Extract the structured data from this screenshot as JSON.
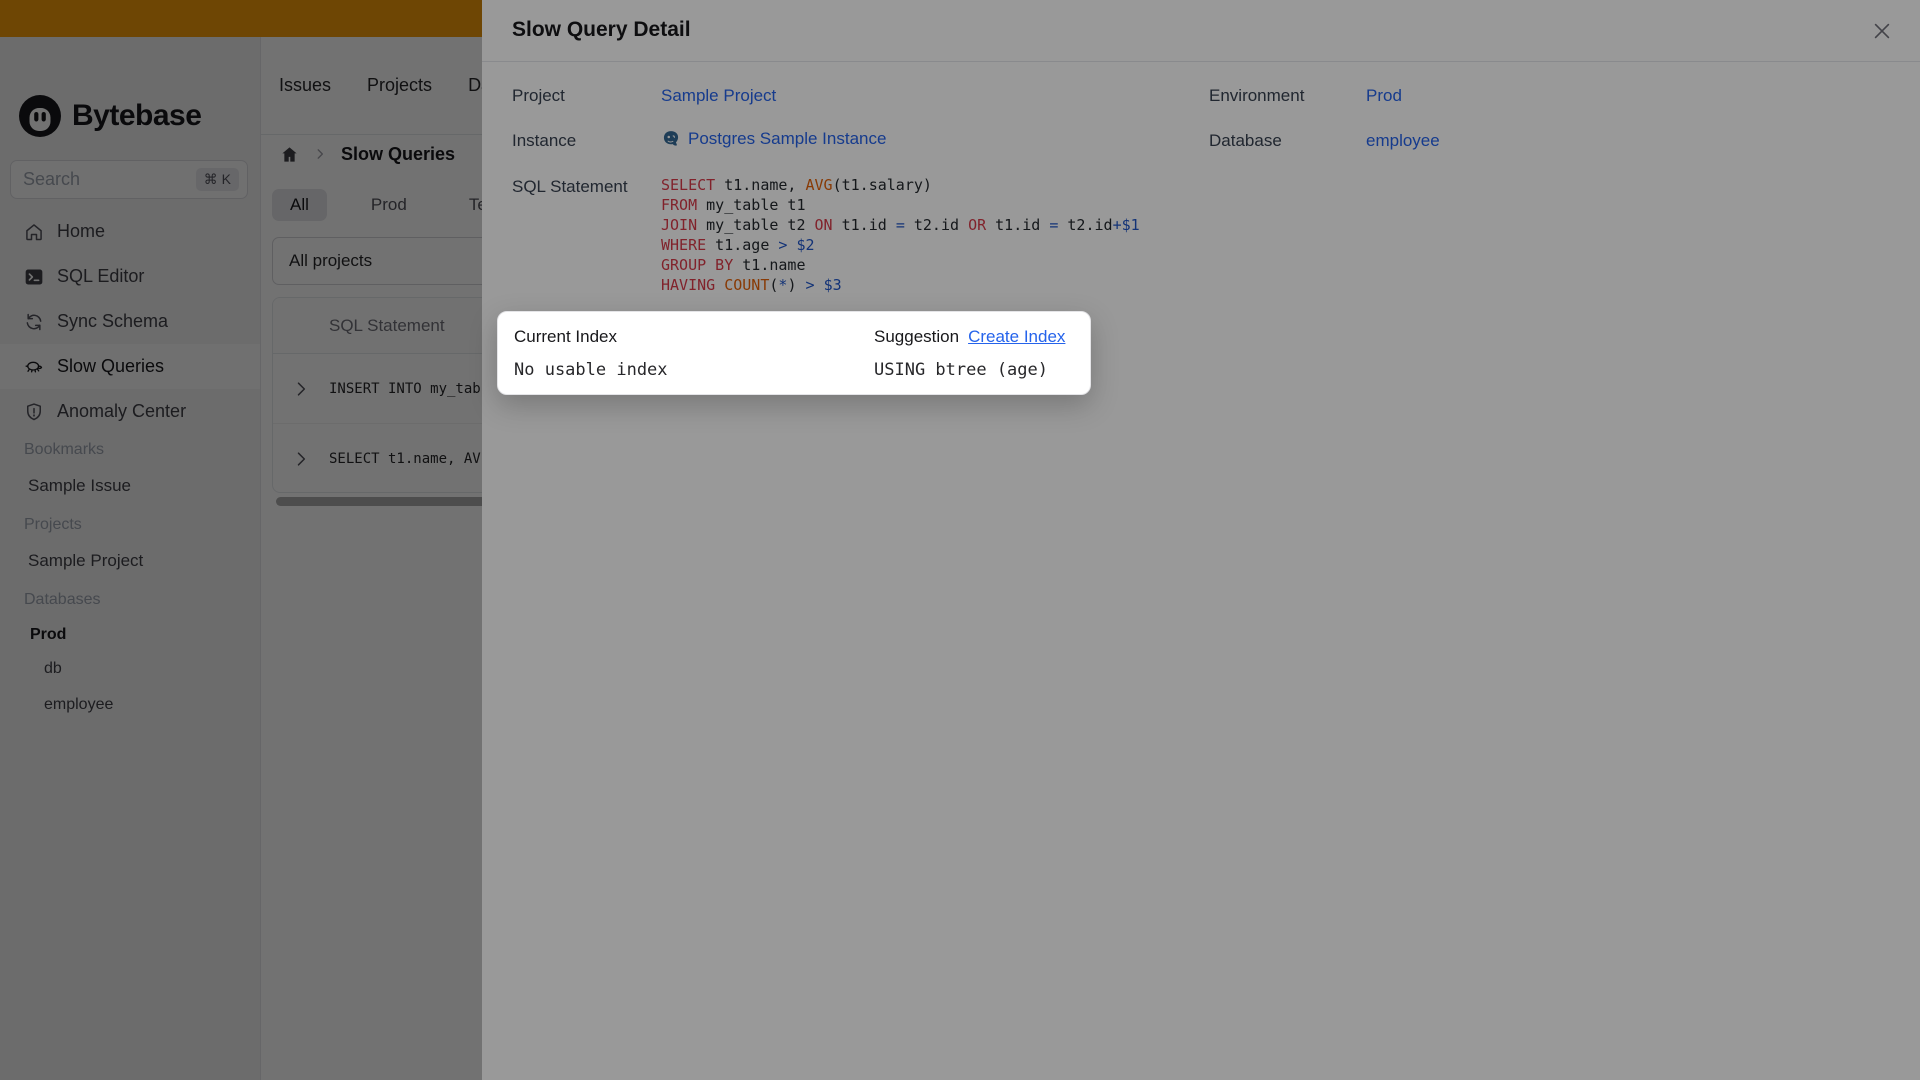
{
  "banner": {
    "color": "#f59e0b"
  },
  "sidebar": {
    "logo_text": "Bytebase",
    "search": {
      "placeholder": "Search",
      "shortcut": "⌘ K"
    },
    "nav": [
      {
        "label": "Home",
        "icon": "home-icon",
        "active": false
      },
      {
        "label": "SQL Editor",
        "icon": "terminal-icon",
        "active": false
      },
      {
        "label": "Sync Schema",
        "icon": "sync-icon",
        "active": false
      },
      {
        "label": "Slow Queries",
        "icon": "turtle-icon",
        "active": true
      },
      {
        "label": "Anomaly Center",
        "icon": "shield-icon",
        "active": false
      }
    ],
    "sections": [
      {
        "title": "Bookmarks",
        "items": [
          {
            "label": "Sample Issue"
          }
        ]
      },
      {
        "title": "Projects",
        "items": [
          {
            "label": "Sample Project"
          }
        ]
      },
      {
        "title": "Databases",
        "items": [
          {
            "label": "Prod"
          },
          {
            "label": "db"
          },
          {
            "label": "employee"
          }
        ]
      }
    ]
  },
  "topnav": {
    "items": [
      "Issues",
      "Projects",
      "Databases"
    ]
  },
  "page": {
    "breadcrumb": {
      "current": "Slow Queries"
    },
    "tabs": [
      {
        "label": "All",
        "active": true
      },
      {
        "label": "Prod",
        "active": false
      },
      {
        "label": "Test",
        "active": false
      }
    ],
    "project_filter": "All projects",
    "table": {
      "header": "SQL Statement",
      "rows": [
        "INSERT INTO my_tab",
        "SELECT t1.name, AV"
      ]
    }
  },
  "modal": {
    "title": "Slow Query Detail",
    "fields": {
      "project_label": "Project",
      "project_value": "Sample Project",
      "instance_label": "Instance",
      "instance_value": "Postgres Sample Instance",
      "environment_label": "Environment",
      "environment_value": "Prod",
      "database_label": "Database",
      "database_value": "employee",
      "sql_label": "SQL Statement"
    },
    "sql_lines": [
      [
        [
          "kw",
          "SELECT"
        ],
        [
          "id",
          " t1.name, "
        ],
        [
          "fn",
          "AVG"
        ],
        [
          "id",
          "(t1.salary)"
        ]
      ],
      [
        [
          "kw",
          "FROM"
        ],
        [
          "id",
          " my_table t1"
        ]
      ],
      [
        [
          "kw",
          "JOIN"
        ],
        [
          "id",
          " my_table t2 "
        ],
        [
          "kw",
          "ON"
        ],
        [
          "id",
          " t1.id "
        ],
        [
          "op",
          "="
        ],
        [
          "id",
          " t2.id "
        ],
        [
          "kw",
          "OR"
        ],
        [
          "id",
          " t1.id "
        ],
        [
          "op",
          "="
        ],
        [
          "id",
          " t2.id"
        ],
        [
          "op",
          "+$1"
        ]
      ],
      [
        [
          "kw",
          "WHERE"
        ],
        [
          "id",
          " t1.age "
        ],
        [
          "op",
          ">"
        ],
        [
          "id",
          " "
        ],
        [
          "op",
          "$2"
        ]
      ],
      [
        [
          "kw",
          "GROUP BY"
        ],
        [
          "id",
          " t1.name"
        ]
      ],
      [
        [
          "kw",
          "HAVING"
        ],
        [
          "id",
          " "
        ],
        [
          "fn",
          "COUNT"
        ],
        [
          "id",
          "("
        ],
        [
          "op",
          "*"
        ],
        [
          "id",
          ") "
        ],
        [
          "op",
          ">"
        ],
        [
          "id",
          " "
        ],
        [
          "op",
          "$3"
        ]
      ]
    ]
  },
  "popup": {
    "current_index_label": "Current Index",
    "current_index_value": "No usable index",
    "suggestion_label": "Suggestion",
    "create_index_link": "Create Index",
    "suggestion_value": "USING btree (age)"
  },
  "colors": {
    "accent_banner": "#f59e0b",
    "link_blue": "#2563eb",
    "sql_keyword": "#d73a49",
    "sql_function": "#e36209",
    "sql_operator_param": "#2056c7",
    "border": "#e5e7eb"
  }
}
